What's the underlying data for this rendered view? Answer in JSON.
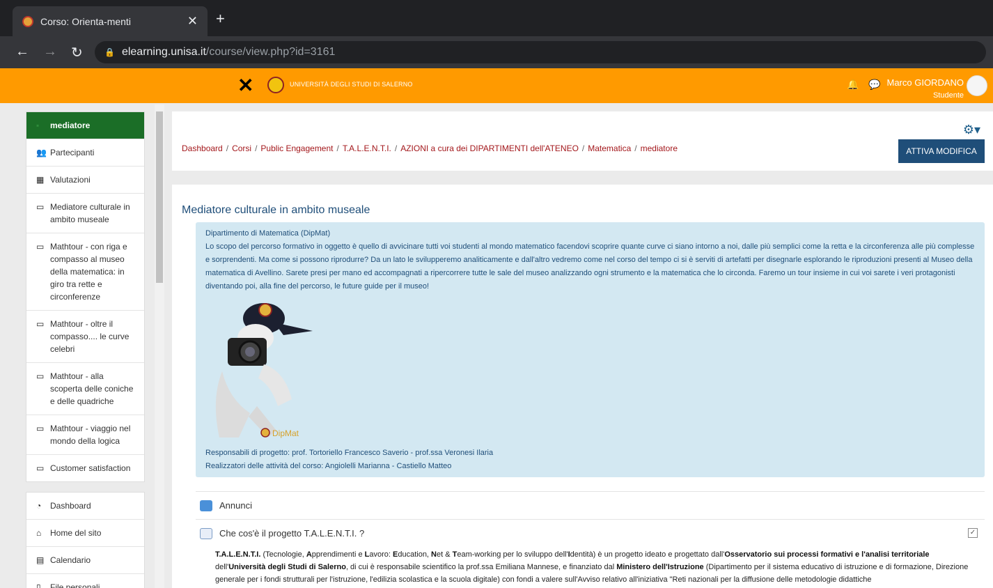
{
  "browser": {
    "tab_title": "Corso: Orienta-menti",
    "tab_close": "✕",
    "new_tab": "+",
    "url_host": "elearning.unisa.it",
    "url_path": "/course/view.php?id=3161"
  },
  "header": {
    "university": "UNIVERSITÀ DEGLI STUDI DI SALERNO",
    "user_name": "Marco GIORDANO",
    "user_role": "Studente"
  },
  "nav": {
    "course_items": [
      {
        "label": "mediatore",
        "icon": "graduation-cap-icon"
      },
      {
        "label": "Partecipanti",
        "icon": "users-icon"
      },
      {
        "label": "Valutazioni",
        "icon": "table-icon"
      },
      {
        "label": "Mediatore culturale in ambito museale",
        "icon": "folder-icon"
      },
      {
        "label": "Mathtour - con riga e compasso al museo della matematica: in giro tra rette e circonferenze",
        "icon": "folder-icon"
      },
      {
        "label": "Mathtour - oltre il compasso.... le curve celebri",
        "icon": "folder-icon"
      },
      {
        "label": "Mathtour - alla scoperta delle coniche e delle quadriche",
        "icon": "folder-icon"
      },
      {
        "label": "Mathtour - viaggio nel mondo della logica",
        "icon": "folder-icon"
      },
      {
        "label": "Customer satisfaction",
        "icon": "folder-icon"
      }
    ],
    "site_items": [
      {
        "label": "Dashboard",
        "icon": "dashboard-icon"
      },
      {
        "label": "Home del sito",
        "icon": "home-icon"
      },
      {
        "label": "Calendario",
        "icon": "calendar-icon"
      },
      {
        "label": "File personali",
        "icon": "file-icon"
      }
    ]
  },
  "breadcrumb": [
    "Dashboard",
    "Corsi",
    "Public Engagement",
    "T.A.L.E.N.T.I.",
    "AZIONI a cura dei DIPARTIMENTI dell'ATENEO",
    "Matematica",
    "mediatore"
  ],
  "edit_button": "ATTIVA MODIFICA",
  "course": {
    "title": "Mediatore culturale in ambito museale",
    "department": "Dipartimento di Matematica (DipMat)",
    "description": "Lo scopo del percorso formativo in oggetto è quello di avvicinare tutti voi studenti al mondo matematico facendovi scoprire quante curve ci siano intorno a noi, dalle più semplici come la retta e la circonferenza alle più complesse e sorprendenti. Ma come si possono riprodurre? Da un lato le svilupperemo analiticamente e dall'altro vedremo come nel corso del tempo ci si è serviti di artefatti per disegnarle esplorando le riproduzioni presenti al Museo della matematica di Avellino. Sarete presi per mano ed accompagnati a ripercorrere tutte le sale del museo analizzando ogni strumento e la matematica che lo circonda. Faremo un tour insieme in cui voi sarete i veri protagonisti diventando poi, alla fine del percorso, le future guide per il museo!",
    "logo_text": "DipMat",
    "responsabili": "Responsabili di progetto: prof. Tortoriello Francesco Saverio - prof.ssa Veronesi Ilaria",
    "realizzatori": "Realizzatori delle attività del corso: Angiolelli Marianna - Castiello Matteo"
  },
  "activities": [
    {
      "label": "Annunci",
      "icon": "forum-icon"
    },
    {
      "label": "Che cos'è il progetto T.A.L.E.N.T.I. ?",
      "icon": "page-icon"
    }
  ],
  "talenti": {
    "b1": "T.A.L.E.N.T.I.",
    "t1": " (Tecnologie, ",
    "b2": "A",
    "t2": "pprendimenti e ",
    "b3": "L",
    "t3": "avoro: ",
    "b4": "E",
    "t4": "ducation, ",
    "b5": "N",
    "t5": "et & ",
    "b6": "T",
    "t6": "eam-working per lo sviluppo dell'",
    "b7": "I",
    "t7": "dentità) è un progetto ideato e progettato dall'",
    "b8": "Osservatorio sui processi formativi e l'analisi territoriale",
    "t8": " dell'",
    "b9": "Università degli Studi di Salerno",
    "t9": ", di cui è responsabile scientifico la prof.ssa Emiliana Mannese, e finanziato dal ",
    "b10": "Ministero dell'Istruzione",
    "t10": " (Dipartimento per il sistema educativo di istruzione e di formazione, Direzione generale per i fondi strutturali per l'istruzione, l'edilizia scolastica e la scuola digitale) con fondi a valere sull'Avviso relativo all'iniziativa \"Reti nazionali per la diffusione delle metodologie didattiche"
  }
}
